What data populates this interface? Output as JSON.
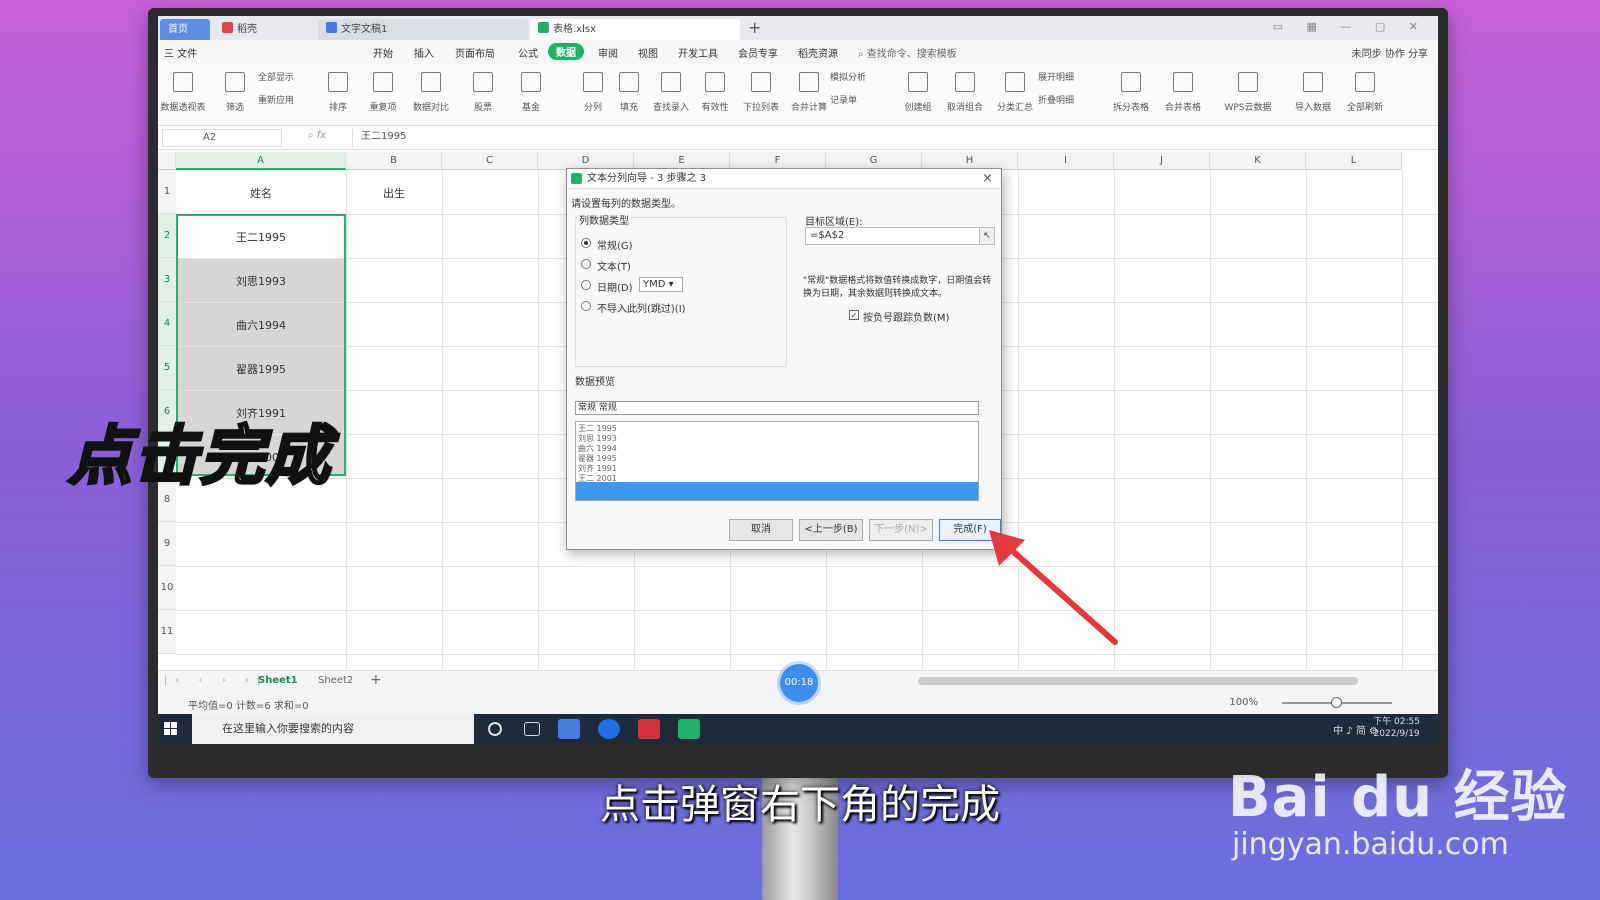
{
  "titlebar": {
    "tabs": [
      {
        "label": "首页"
      },
      {
        "label": "稻壳"
      },
      {
        "label": "文字文稿1"
      },
      {
        "label": "表格.xlsx"
      }
    ],
    "new_tab": "+"
  },
  "menubar": {
    "file": "三 文件",
    "items": [
      "开始",
      "插入",
      "页面布局",
      "公式",
      "数据",
      "审阅",
      "视图",
      "开发工具",
      "会员专享",
      "稻壳资源"
    ],
    "active": "数据",
    "search": "查找命令、搜索模板",
    "right": "未同步  协作  分享"
  },
  "ribbon": {
    "buttons": [
      "数据透视表",
      "筛选",
      "排序",
      "重复项",
      "数据对比",
      "股票",
      "基金",
      "分列",
      "填充",
      "查找录入",
      "有效性",
      "下拉列表",
      "合并计算",
      "记录单",
      "创建组",
      "取消组合",
      "分类汇总",
      "拆分表格",
      "合并表格",
      "WPS云数据",
      "导入数据",
      "全部刷新"
    ],
    "small": [
      "全部显示",
      "重新应用",
      "模拟分析",
      "展开明细",
      "折叠明细"
    ]
  },
  "formula_bar": {
    "name_box": "A2",
    "fx": "fx",
    "content": "王二1995"
  },
  "grid": {
    "columns": [
      "A",
      "B",
      "C",
      "D",
      "E",
      "F",
      "G",
      "H",
      "I",
      "J",
      "K",
      "L"
    ],
    "rows": [
      "1",
      "2",
      "3",
      "4",
      "5",
      "6",
      "7",
      "8",
      "9",
      "10",
      "11"
    ],
    "cells": {
      "A1": "姓名",
      "B1": "出生",
      "A2": "王二1995",
      "A3": "刘思1993",
      "A4": "曲六1994",
      "A5": "翟器1995",
      "A6": "刘齐1991",
      "A7": "王二2001"
    }
  },
  "dialog": {
    "title": "文本分列向导 - 3 步骤之 3",
    "close": "×",
    "instruction": "请设置每列的数据类型。",
    "column_type_label": "列数据类型",
    "options": [
      "常规(G)",
      "文本(T)",
      "日期(D)",
      "不导入此列(跳过)(I)"
    ],
    "date_format": "YMD",
    "target_label": "目标区域(E):",
    "target_value": "=$A$2",
    "note": "\"常规\"数据格式将数值转换成数字，日期值会转换为日期，其余数据则转换成文本。",
    "checkbox_label": "按负号跟踪负数(M)",
    "preview_label": "数据预览",
    "preview_header": "常规 常规",
    "preview_rows": [
      "王二 1995",
      "刘思 1993",
      "曲六 1994",
      "翟器 1995",
      "刘齐 1991",
      "王二 2001"
    ],
    "buttons": {
      "cancel": "取消",
      "back": "<上一步(B)",
      "next": "下一步(N)>",
      "finish": "完成(F)"
    }
  },
  "sheets": {
    "tabs": [
      "Sheet1",
      "Sheet2"
    ],
    "add": "+"
  },
  "status": {
    "stats": "平均值=0  计数=6  求和=0",
    "zoom": "100%",
    "timer": "00:18"
  },
  "taskbar": {
    "search": "在这里输入你要搜索的内容",
    "tray": "中 ♪ 简 ⚙",
    "time": "下午 02:55",
    "date": "2022/9/19"
  },
  "overlay": {
    "caption": "点击完成",
    "subtitle": "点击弹窗右下角的完成",
    "watermark": "Bai du 经验",
    "watermark_url": "jingyan.baidu.com"
  },
  "colors": {
    "accent": "#1fb26b",
    "selection": "#3d97f0",
    "arrow": "#e8383d"
  }
}
